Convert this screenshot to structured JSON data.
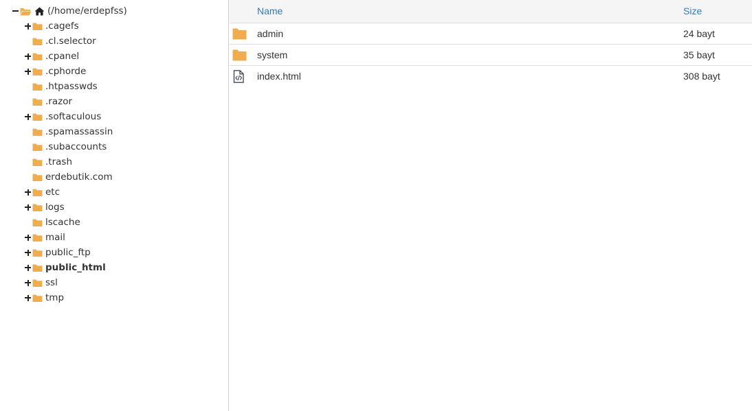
{
  "tree": {
    "root": {
      "label": "(/home/erdepfss)",
      "expanded": true,
      "icon": "open-folder-icon"
    },
    "items": [
      {
        "label": ".cagefs",
        "expandable": true,
        "bold": false
      },
      {
        "label": ".cl.selector",
        "expandable": false,
        "bold": false
      },
      {
        "label": ".cpanel",
        "expandable": true,
        "bold": false
      },
      {
        "label": ".cphorde",
        "expandable": true,
        "bold": false
      },
      {
        "label": ".htpasswds",
        "expandable": false,
        "bold": false
      },
      {
        "label": ".razor",
        "expandable": false,
        "bold": false
      },
      {
        "label": ".softaculous",
        "expandable": true,
        "bold": false
      },
      {
        "label": ".spamassassin",
        "expandable": false,
        "bold": false
      },
      {
        "label": ".subaccounts",
        "expandable": false,
        "bold": false
      },
      {
        "label": ".trash",
        "expandable": false,
        "bold": false
      },
      {
        "label": "erdebutik.com",
        "expandable": false,
        "bold": false
      },
      {
        "label": "etc",
        "expandable": true,
        "bold": false
      },
      {
        "label": "logs",
        "expandable": true,
        "bold": false
      },
      {
        "label": "lscache",
        "expandable": false,
        "bold": false
      },
      {
        "label": "mail",
        "expandable": true,
        "bold": false
      },
      {
        "label": "public_ftp",
        "expandable": true,
        "bold": false
      },
      {
        "label": "public_html",
        "expandable": true,
        "bold": true
      },
      {
        "label": "ssl",
        "expandable": true,
        "bold": false
      },
      {
        "label": "tmp",
        "expandable": true,
        "bold": false
      }
    ]
  },
  "list": {
    "headers": {
      "name": "Name",
      "size": "Size"
    },
    "rows": [
      {
        "name": "admin",
        "size": "24 bayt",
        "type": "folder"
      },
      {
        "name": "system",
        "size": "35 bayt",
        "type": "folder"
      },
      {
        "name": "index.html",
        "size": "308 bayt",
        "type": "html-file"
      }
    ]
  },
  "colors": {
    "folder": "#f0ad4e",
    "link": "#337ab7",
    "text": "#333333",
    "header_bg": "#f5f5f5",
    "border": "#dddddd"
  }
}
